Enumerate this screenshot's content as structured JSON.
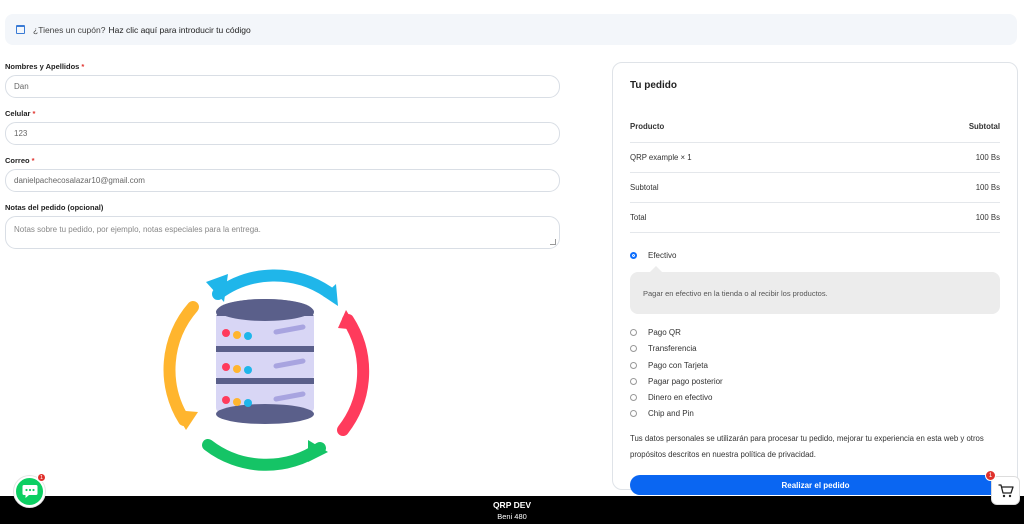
{
  "coupon": {
    "prefix": "¿Tienes un cupón?",
    "link": "Haz clic aquí para introducir tu código"
  },
  "form": {
    "name_label": "Nombres y Apellidos",
    "name_value": "Dan",
    "phone_label": "Celular",
    "phone_value": "123",
    "email_label": "Correo",
    "email_value": "danielpachecosalazar10@gmail.com",
    "notes_label": "Notas del pedido (opcional)",
    "notes_placeholder": "Notas sobre tu pedido, por ejemplo, notas especiales para la entrega.",
    "required_mark": "*"
  },
  "order": {
    "title": "Tu pedido",
    "col_product": "Producto",
    "col_subtotal": "Subtotal",
    "item_name": "QRP example × 1",
    "item_price": "100 Bs",
    "subtotal_label": "Subtotal",
    "subtotal_value": "100 Bs",
    "total_label": "Total",
    "total_value": "100 Bs"
  },
  "payment": {
    "selected": "Efectivo",
    "selected_desc": "Pagar en efectivo en la tienda o al recibir los productos.",
    "options": [
      "Pago QR",
      "Transferencia",
      "Pago con Tarjeta",
      "Pagar pago posterior",
      "Dinero en efectivo",
      "Chip and Pin"
    ]
  },
  "privacy_text": "Tus datos personales se utilizarán para procesar tu pedido, mejorar tu experiencia en esta web y otros propósitos descritos en nuestra política de privacidad.",
  "place_order": "Realizar el pedido",
  "footer": {
    "title": "QRP DEV",
    "address": "Beni 480"
  },
  "chat_badge": "1",
  "cart_badge": "1",
  "colors": {
    "accent": "#0a66f2",
    "chat": "#0ccf62",
    "badge": "#e0312c"
  }
}
